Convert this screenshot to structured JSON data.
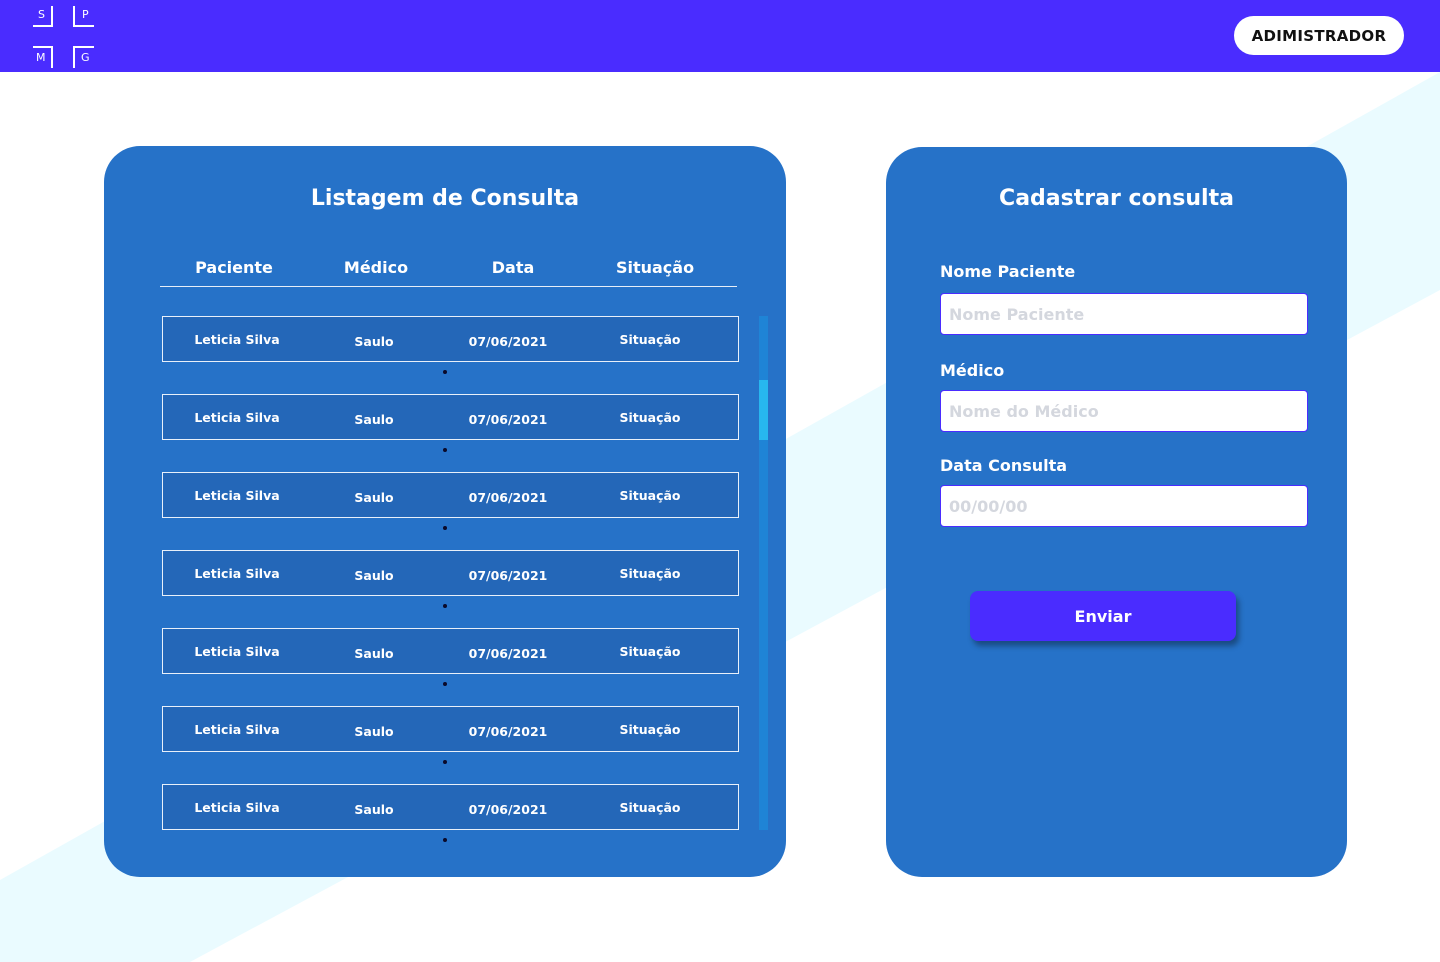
{
  "header": {
    "logo_letters": [
      "S",
      "P",
      "M",
      "G"
    ],
    "admin_label": "ADIMISTRADOR"
  },
  "list_panel": {
    "title": "Listagem de Consulta",
    "columns": [
      "Paciente",
      "Médico",
      "Data",
      "Situação"
    ],
    "rows": [
      {
        "paciente": "Leticia Silva",
        "medico": "Saulo",
        "data": "07/06/2021",
        "situacao": "Situação"
      },
      {
        "paciente": "Leticia Silva",
        "medico": "Saulo",
        "data": "07/06/2021",
        "situacao": "Situação"
      },
      {
        "paciente": "Leticia Silva",
        "medico": "Saulo",
        "data": "07/06/2021",
        "situacao": "Situação"
      },
      {
        "paciente": "Leticia Silva",
        "medico": "Saulo",
        "data": "07/06/2021",
        "situacao": "Situação"
      },
      {
        "paciente": "Leticia Silva",
        "medico": "Saulo",
        "data": "07/06/2021",
        "situacao": "Situação"
      },
      {
        "paciente": "Leticia Silva",
        "medico": "Saulo",
        "data": "07/06/2021",
        "situacao": "Situação"
      },
      {
        "paciente": "Leticia Silva",
        "medico": "Saulo",
        "data": "07/06/2021",
        "situacao": "Situação"
      }
    ]
  },
  "form_panel": {
    "title": "Cadastrar consulta",
    "patient_label": "Nome Paciente",
    "patient_placeholder": "Nome Paciente",
    "doctor_label": "Médico",
    "doctor_placeholder": "Nome do Médico",
    "date_label": "Data Consulta",
    "date_placeholder": "00/00/00",
    "submit_label": "Enviar"
  },
  "colors": {
    "topbar": "#4a2cff",
    "card": "#2672c8",
    "button": "#4a2cff",
    "stripe": "#eafaff"
  }
}
